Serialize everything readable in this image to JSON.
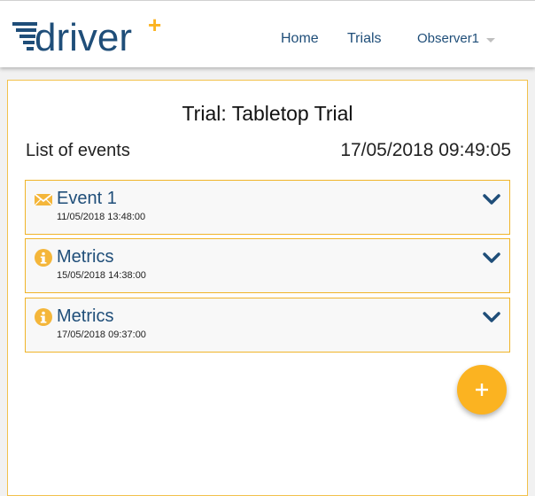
{
  "header": {
    "logo_text": "driver",
    "logo_plus": "+",
    "nav": {
      "home": "Home",
      "trials": "Trials",
      "user": "Observer1"
    }
  },
  "main": {
    "trial_title": "Trial: Tabletop Trial",
    "list_title": "List of events",
    "datetime": "17/05/2018 09:49:05",
    "events": [
      {
        "title": "Event 1",
        "date": "11/05/2018 13:48:00",
        "icon": "envelope-icon"
      },
      {
        "title": "Metrics",
        "date": "15/05/2018 14:38:00",
        "icon": "info-icon"
      },
      {
        "title": "Metrics",
        "date": "17/05/2018 09:37:00",
        "icon": "info-icon"
      }
    ],
    "add_button_icon": "plus-icon"
  },
  "colors": {
    "accent": "#fbb321",
    "nav_text": "#1f4e79",
    "event_border": "#f0b429"
  }
}
